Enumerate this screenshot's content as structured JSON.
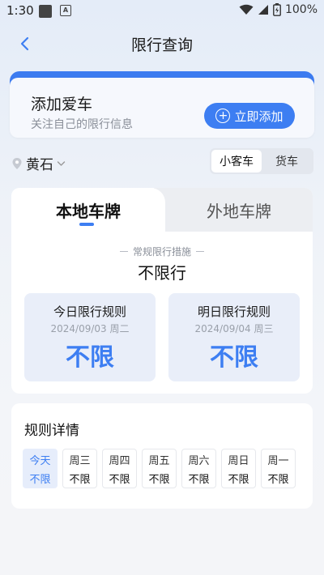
{
  "status_bar": {
    "time": "1:30",
    "battery": "100%",
    "icons": [
      "notification-square-icon",
      "app-a-icon",
      "wifi-icon",
      "signal-icon",
      "battery-icon"
    ]
  },
  "header": {
    "title": "限行查询",
    "back_icon": "chevron-left-icon"
  },
  "add_car": {
    "title": "添加爱车",
    "subtitle": "关注自己的限行信息",
    "button_label": "立即添加",
    "button_icon": "plus-circle-icon"
  },
  "location": {
    "city": "黄石",
    "pin_icon": "location-pin-icon",
    "dropdown_icon": "chevron-down-icon"
  },
  "vehicle_types": {
    "options": [
      "小客车",
      "货车"
    ],
    "selected": "小客车"
  },
  "plate_tabs": {
    "local": "本地车牌",
    "other": "外地车牌",
    "selected": "本地车牌"
  },
  "measures": {
    "caption": "常规限行措施",
    "value": "不限行"
  },
  "today": {
    "title": "今日限行规则",
    "date": "2024/09/03 周二",
    "value": "不限"
  },
  "tomorrow": {
    "title": "明日限行规则",
    "date": "2024/09/04 周三",
    "value": "不限"
  },
  "details": {
    "title": "规则详情",
    "days": [
      {
        "name": "今天",
        "value": "不限"
      },
      {
        "name": "周三",
        "value": "不限"
      },
      {
        "name": "周四",
        "value": "不限"
      },
      {
        "name": "周五",
        "value": "不限"
      },
      {
        "name": "周六",
        "value": "不限"
      },
      {
        "name": "周日",
        "value": "不限"
      },
      {
        "name": "周一",
        "value": "不限"
      }
    ]
  },
  "colors": {
    "accent": "#3d7ef2",
    "card_band": "#3c7bf0",
    "rule_box_bg": "#e9eef9",
    "muted_text": "#8a8f99"
  }
}
